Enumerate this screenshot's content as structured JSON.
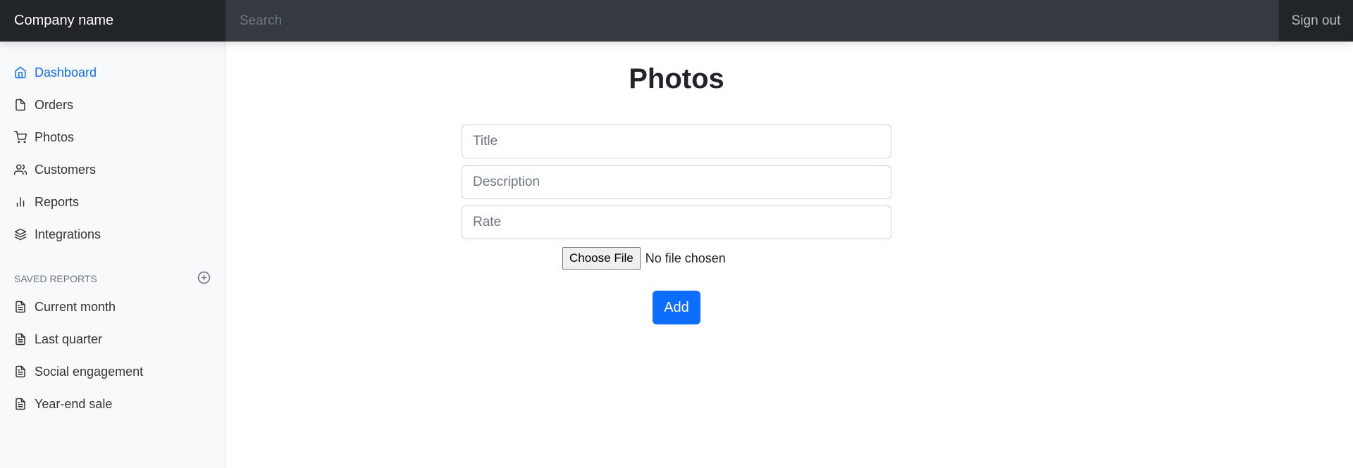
{
  "navbar": {
    "brand": "Company name",
    "search_placeholder": "Search",
    "signout_label": "Sign out"
  },
  "sidebar": {
    "items": [
      {
        "label": "Dashboard",
        "icon": "home-icon",
        "active": true
      },
      {
        "label": "Orders",
        "icon": "file-icon"
      },
      {
        "label": "Photos",
        "icon": "shopping-cart-icon"
      },
      {
        "label": "Customers",
        "icon": "users-icon"
      },
      {
        "label": "Reports",
        "icon": "bar-chart-icon"
      },
      {
        "label": "Integrations",
        "icon": "layers-icon"
      }
    ],
    "saved_reports_heading": "SAVED REPORTS",
    "saved_reports": [
      {
        "label": "Current month",
        "icon": "file-text-icon"
      },
      {
        "label": "Last quarter",
        "icon": "file-text-icon"
      },
      {
        "label": "Social engagement",
        "icon": "file-text-icon"
      },
      {
        "label": "Year-end sale",
        "icon": "file-text-icon"
      }
    ]
  },
  "main": {
    "title": "Photos",
    "form": {
      "title_placeholder": "Title",
      "description_placeholder": "Description",
      "rate_placeholder": "Rate",
      "file_button_label": "Choose File",
      "file_status": "No file chosen",
      "submit_label": "Add"
    }
  },
  "colors": {
    "accent": "#0d6efd",
    "navbar_bg": "#343a40",
    "brand_bg": "#212529",
    "sidebar_bg": "#f8f9fa"
  }
}
